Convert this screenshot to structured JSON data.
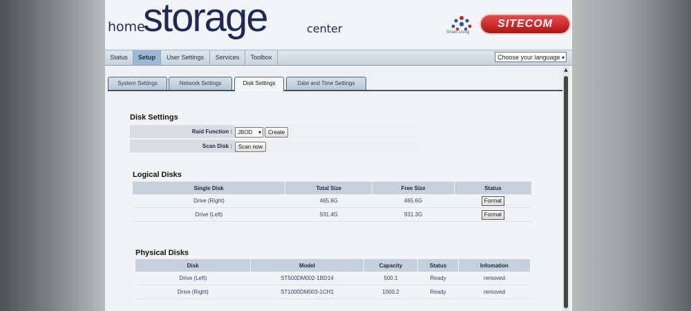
{
  "header": {
    "logo_home": "home",
    "logo_storage": "storage",
    "logo_center": "center",
    "smart_living": "Smart Living",
    "brand": "SITECOM"
  },
  "nav": {
    "items": [
      {
        "label": "Status",
        "active": false
      },
      {
        "label": "Setup",
        "active": true
      },
      {
        "label": "User Settings",
        "active": false
      },
      {
        "label": "Services",
        "active": false
      },
      {
        "label": "Toolbox",
        "active": false
      }
    ],
    "language_select": "Choose your language"
  },
  "subtabs": [
    {
      "label": "System Settings",
      "active": false
    },
    {
      "label": "Network Settings",
      "active": false
    },
    {
      "label": "Disk Settings",
      "active": true
    },
    {
      "label": "Date and Time Settings",
      "active": false
    }
  ],
  "disk_settings": {
    "title": "Disk Settings",
    "raid_label": "Raid Function :",
    "raid_value": "JBOD",
    "create_button": "Create",
    "scan_label": "Scan Disk :",
    "scan_button": "Scan now"
  },
  "logical_disks": {
    "title": "Logical Disks",
    "headers": [
      "Single Disk",
      "Total Size",
      "Free Size",
      "Status"
    ],
    "rows": [
      {
        "disk": "Drive (Right)",
        "total": "465.6G",
        "free": "465.6G",
        "action": "Format"
      },
      {
        "disk": "Drive (Left)",
        "total": "931.4G",
        "free": "931.3G",
        "action": "Format"
      }
    ]
  },
  "physical_disks": {
    "title": "Physical Disks",
    "headers": [
      "Disk",
      "Model",
      "Capacity",
      "Status",
      "Infomation"
    ],
    "rows": [
      {
        "disk": "Drive (Left)",
        "model": "ST500DM002-1BD14",
        "capacity": "500.1",
        "status": "Ready",
        "info": "removed"
      },
      {
        "disk": "Drive (Right)",
        "model": "ST1000DM003-1CH1",
        "capacity": "1000.2",
        "status": "Ready",
        "info": "removed"
      }
    ]
  },
  "colors": {
    "brand_red": "#c41e1e",
    "logo_navy": "#1d2a55",
    "header_row": "#c5d0db",
    "active_nav": "#9cb8d4"
  }
}
